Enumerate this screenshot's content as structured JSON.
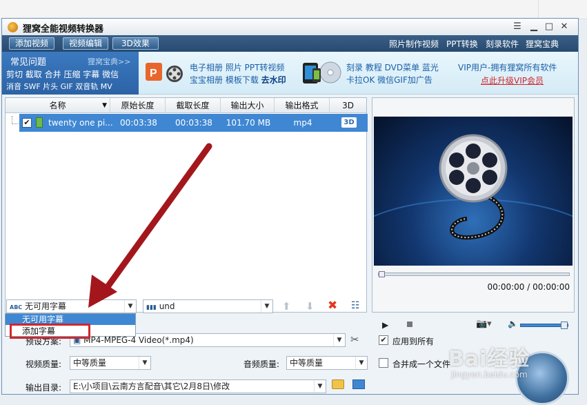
{
  "window": {
    "title": "狸窝全能视频转换器"
  },
  "toolbar": {
    "add_video": "添加视频",
    "video_edit": "视频编辑",
    "effect_3d": "3D效果",
    "links": [
      "照片制作视频",
      "PPT转换",
      "刻录软件",
      "狸窝宝典"
    ]
  },
  "banner": {
    "faq_title": "常见问题",
    "faq_more": "狸窝宝典>>",
    "faq_line1": "剪切 截取 合并 压缩 字幕 微信",
    "faq_line2": "消音 SWF 片头 GIF 双音轨 MV",
    "ad1_line1": "电子相册  照片 PPT转视频",
    "ad1_line2a": "宝宝相册  模板下载 ",
    "ad1_line2b": "去水印",
    "ad2_line1": "刻录  教程  DVD菜单  蓝光",
    "ad2_line2": "卡拉OK 微信GIF加广告",
    "vip_line1": "VIP用户-拥有狸窝所有软件",
    "vip_line2": "点此升级VIP会员"
  },
  "table": {
    "columns": [
      "名称",
      "原始长度",
      "截取长度",
      "输出大小",
      "输出格式",
      "3D"
    ],
    "rows": [
      {
        "name": "twenty one pi...",
        "original_length": "00:03:38",
        "clip_length": "00:03:38",
        "output_size": "101.70 MB",
        "format": "mp4",
        "checked": true
      }
    ]
  },
  "preview": {
    "time": "00:00:00 / 00:00:00",
    "seek_progress": 0
  },
  "subtitle": {
    "selected": "无可用字幕",
    "options": [
      "无可用字幕",
      "添加字幕"
    ]
  },
  "audio": {
    "selected": "und"
  },
  "settings": {
    "preset_label": "预设方案:",
    "preset_value": "MP4-MPEG-4 Video(*.mp4)",
    "video_quality_label": "视频质量:",
    "video_quality_value": "中等质量",
    "audio_quality_label": "音频质量:",
    "audio_quality_value": "中等质量",
    "output_dir_label": "输出目录:",
    "output_dir_value": "E:\\小项目\\云南方言配音\\其它\\2月8日\\修改",
    "apply_all": "应用到所有",
    "apply_all_checked": true,
    "merge_one": "合并成一个文件",
    "merge_one_checked": false
  },
  "watermark": {
    "text": "Bai经验",
    "sub": "jingyan.baidu.com"
  },
  "colors": {
    "accent": "#3f87d3",
    "toolbar": "#274a70",
    "highlight": "#d0262d",
    "arrow": "#a3171c"
  }
}
